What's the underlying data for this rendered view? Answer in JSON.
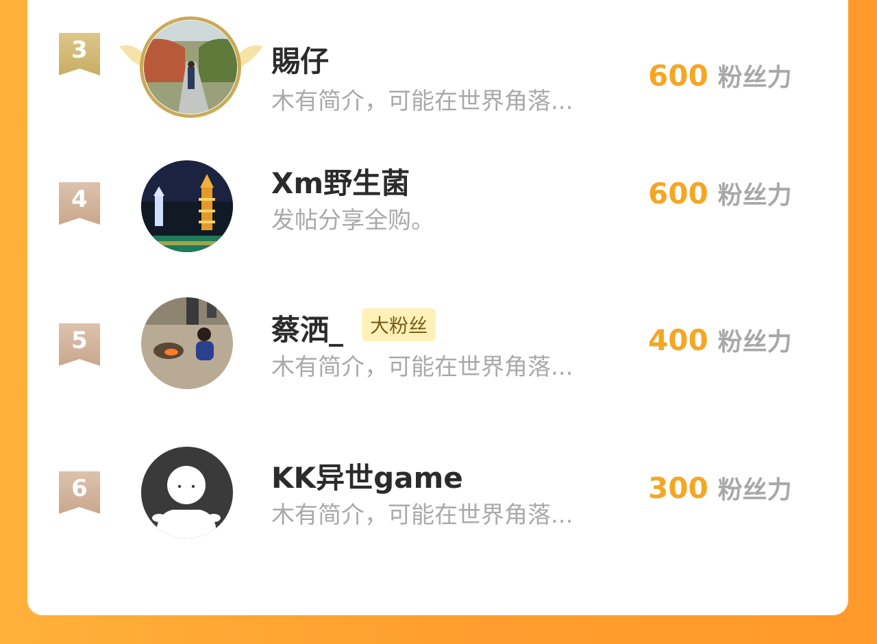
{
  "colors": {
    "accent": "#f5a623",
    "background_orange": "#ff9f2e",
    "badge_bg": "#fff1b8"
  },
  "rows": [
    {
      "rank": "3",
      "name": "賜仔",
      "desc": "木有简介，可能在世界角落...",
      "score": "600",
      "unit": "粉丝力",
      "avatar": "path-photo"
    },
    {
      "rank": "4",
      "name": "Xm野生菌",
      "desc": "发帖分享全购。",
      "score": "600",
      "unit": "粉丝力",
      "avatar": "pagoda-photo"
    },
    {
      "rank": "5",
      "name": "蔡洒_",
      "badge": "大粉丝",
      "desc": "木有简介，可能在世界角落...",
      "score": "400",
      "unit": "粉丝力",
      "avatar": "campfire-photo"
    },
    {
      "rank": "6",
      "name": "KK异世game",
      "desc": "木有简介，可能在世界角落...",
      "score": "300",
      "unit": "粉丝力",
      "avatar": "default-avatar"
    }
  ]
}
